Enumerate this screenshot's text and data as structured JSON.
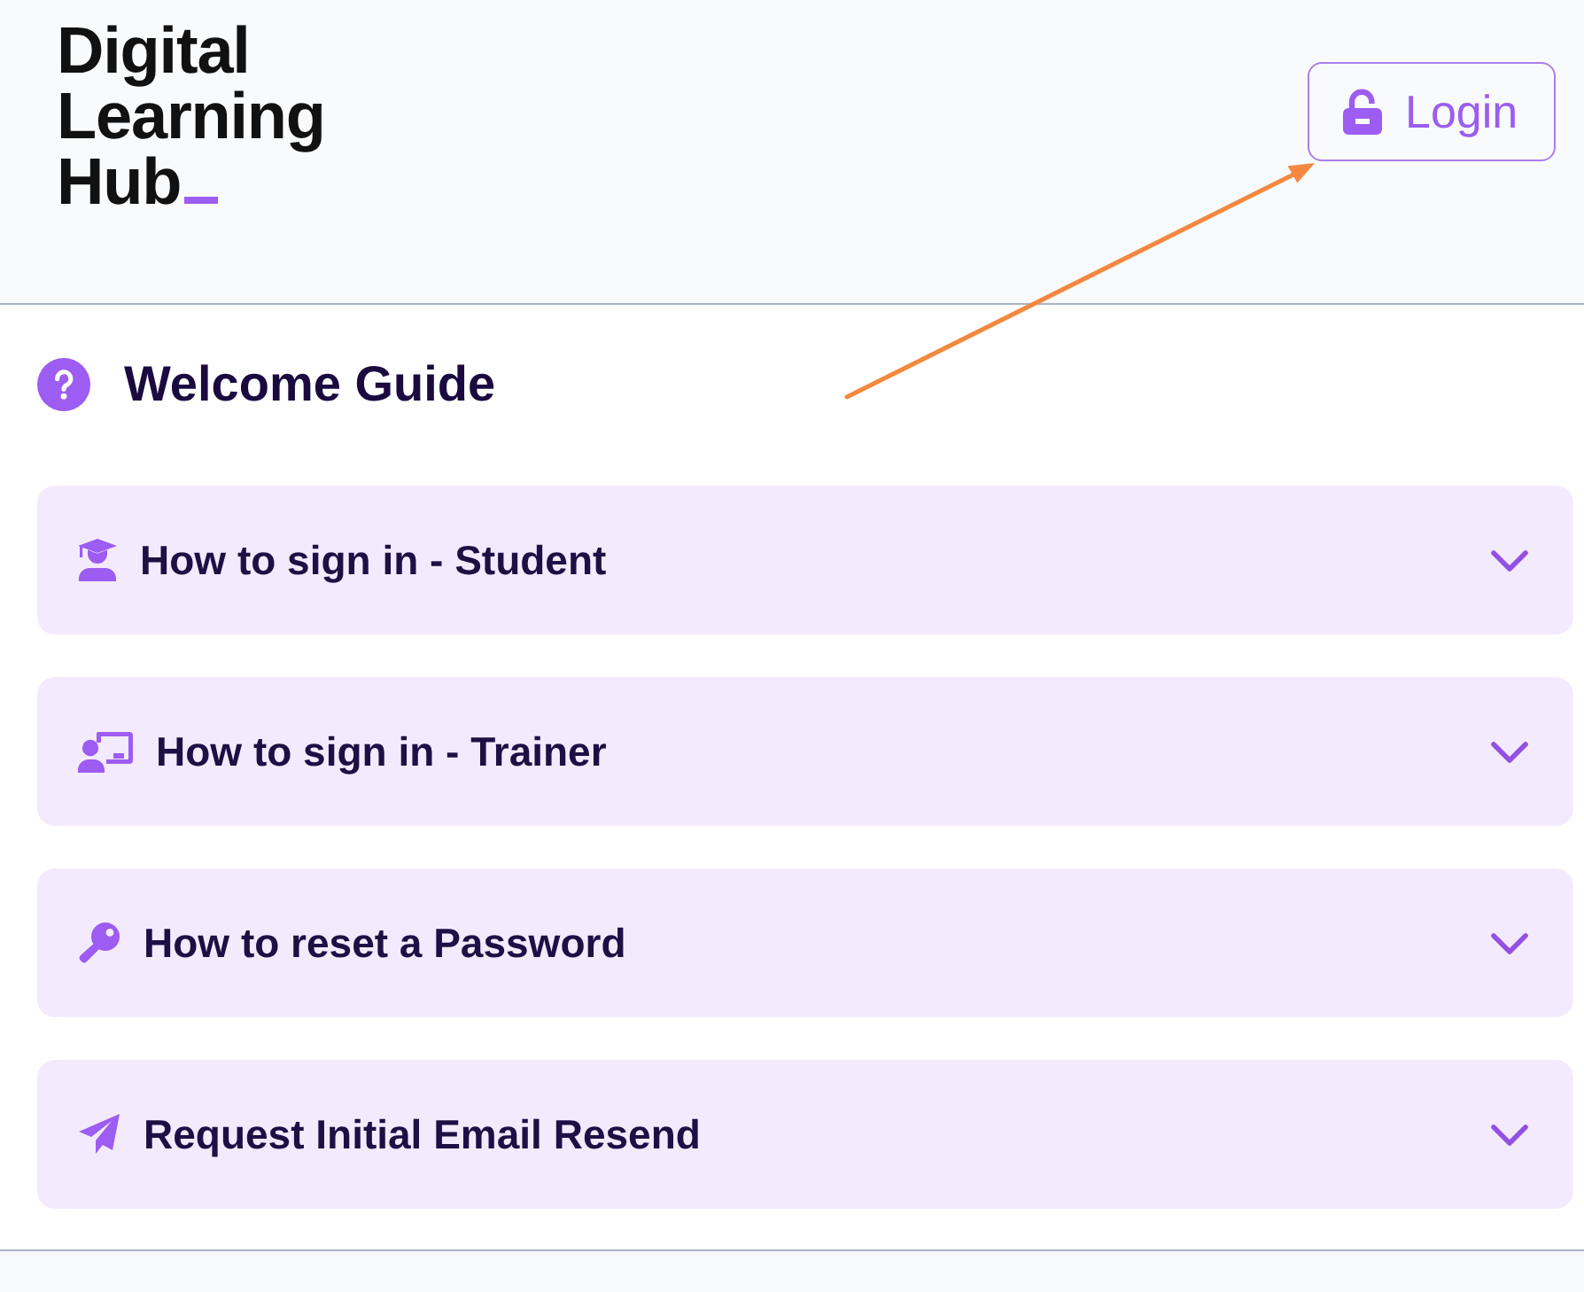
{
  "header": {
    "logo_lines": [
      "Digital",
      "Learning",
      "Hub"
    ],
    "login_button": "Login"
  },
  "welcome_guide": {
    "title": "Welcome Guide",
    "items": [
      {
        "label": "How to sign in - Student",
        "expanded": false
      },
      {
        "label": "How to sign in - Trainer",
        "expanded": false
      },
      {
        "label": "How to reset a Password",
        "expanded": false
      },
      {
        "label": "Request Initial Email Resend",
        "expanded": false
      }
    ]
  }
}
